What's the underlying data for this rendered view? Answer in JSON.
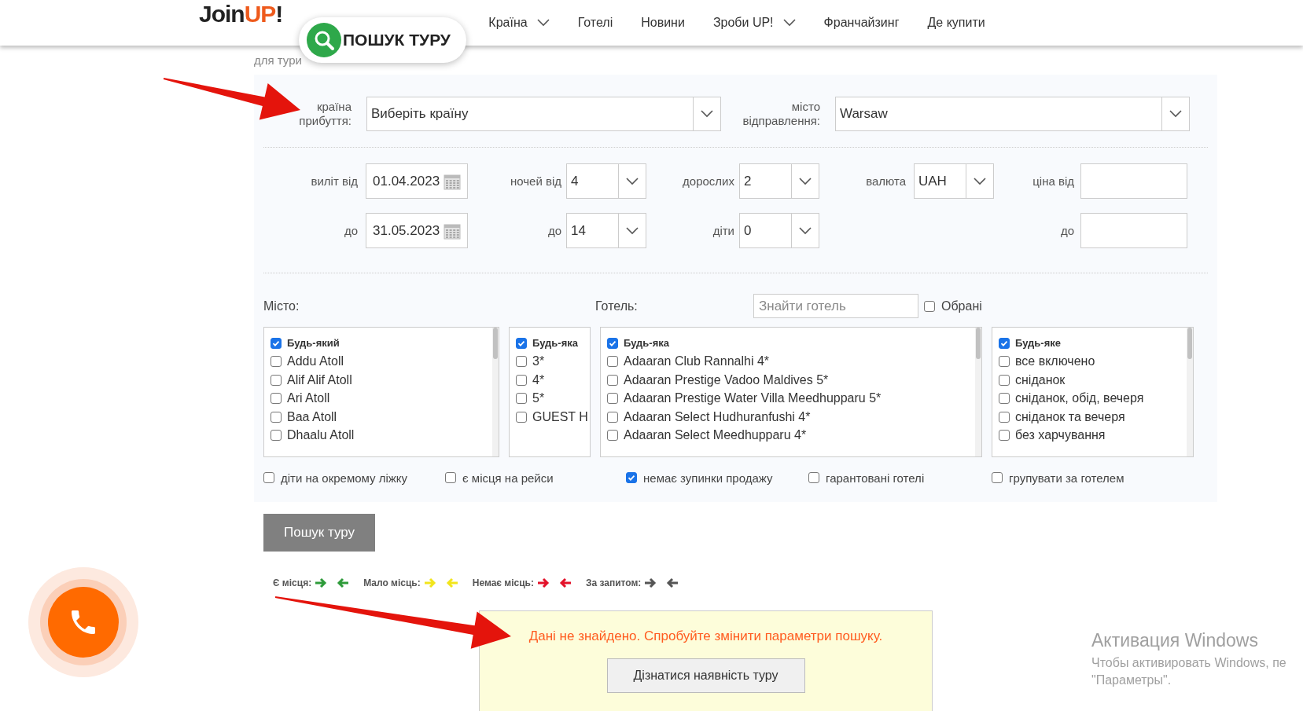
{
  "header": {
    "logo": [
      {
        "text": "Join",
        "color": "#222222"
      },
      {
        "text": "UP",
        "color": "#ee5a1c"
      },
      {
        "text": "!",
        "color": "#222222"
      }
    ],
    "nav": [
      {
        "label": "Країна",
        "dropdown": true
      },
      {
        "label": "Готелі",
        "dropdown": false
      },
      {
        "label": "Новини",
        "dropdown": false
      },
      {
        "label": "Зроби UP!",
        "dropdown": true
      },
      {
        "label": "Франчайзинг",
        "dropdown": false
      },
      {
        "label": "Де купити",
        "dropdown": false
      }
    ],
    "search_button": "ПОШУК ТУРУ"
  },
  "subtitle": "для тури",
  "form": {
    "country": {
      "label": "країна\nприбуття:",
      "value": "Виберіть країну"
    },
    "departure": {
      "label": "місто\nвідправлення:",
      "value": "Warsaw"
    },
    "row_from": [
      {
        "kind": "date",
        "label": "виліт від",
        "value": "01.04.2023"
      },
      {
        "kind": "select",
        "label": "ночей від",
        "value": "4"
      },
      {
        "kind": "select",
        "label": "дорослих",
        "value": "2"
      },
      {
        "kind": "select",
        "label": "валюта",
        "value": "UAH"
      },
      {
        "kind": "input",
        "label": "ціна від"
      }
    ],
    "row_to": [
      {
        "kind": "date",
        "label": "до",
        "value": "31.05.2023"
      },
      {
        "kind": "select",
        "label": "до",
        "value": "14"
      },
      {
        "kind": "select",
        "label": "діти",
        "value": "0"
      },
      {
        "kind": "blank"
      },
      {
        "kind": "input",
        "label": "до"
      }
    ],
    "city_label": "Місто:",
    "hotel_label": "Готель:",
    "hotel_search": {
      "placeholder": "Знайти готель"
    },
    "favorites": {
      "label": "Обрані",
      "checked": false
    },
    "lists": [
      {
        "items": [
          {
            "kind": "any",
            "label": "Будь-який",
            "checked": true
          },
          {
            "kind": "option",
            "label": "Addu Atoll",
            "checked": false
          },
          {
            "kind": "option",
            "label": "Alif Alif Atoll",
            "checked": false
          },
          {
            "kind": "option",
            "label": "Ari Atoll",
            "checked": false
          },
          {
            "kind": "option",
            "label": "Baa Atoll",
            "checked": false
          },
          {
            "kind": "option",
            "label": "Dhaalu Atoll",
            "checked": false
          }
        ]
      },
      {
        "items": [
          {
            "kind": "any",
            "label": "Будь-яка",
            "checked": true
          },
          {
            "kind": "option",
            "label": "3*",
            "checked": false
          },
          {
            "kind": "option",
            "label": "4*",
            "checked": false
          },
          {
            "kind": "option",
            "label": "5*",
            "checked": false
          },
          {
            "kind": "option",
            "label": "GUEST H",
            "checked": false
          }
        ]
      },
      {
        "items": [
          {
            "kind": "any",
            "label": "Будь-яка",
            "checked": true
          },
          {
            "kind": "option",
            "label": "Adaaran Club Rannalhi 4*",
            "checked": false
          },
          {
            "kind": "option",
            "label": "Adaaran Prestige Vadoo Maldives 5*",
            "checked": false
          },
          {
            "kind": "option",
            "label": "Adaaran Prestige Water Villa Meedhupparu 5*",
            "checked": false
          },
          {
            "kind": "option",
            "label": "Adaaran Select Hudhuranfushi 4*",
            "checked": false
          },
          {
            "kind": "option",
            "label": "Adaaran Select Meedhupparu 4*",
            "checked": false
          }
        ]
      },
      {
        "items": [
          {
            "kind": "any",
            "label": "Будь-яке",
            "checked": true
          },
          {
            "kind": "option",
            "label": "все включено",
            "checked": false
          },
          {
            "kind": "option",
            "label": "сніданок",
            "checked": false
          },
          {
            "kind": "option",
            "label": "сніданок, обід, вечеря",
            "checked": false
          },
          {
            "kind": "option",
            "label": "сніданок та вечеря",
            "checked": false
          },
          {
            "kind": "option",
            "label": "без харчування",
            "checked": false
          }
        ]
      }
    ],
    "options": [
      {
        "label": "діти на окремому ліжку",
        "checked": false
      },
      {
        "label": "є місця на рейси",
        "checked": false
      },
      {
        "label": "немає зупинки продажу",
        "checked": true
      },
      {
        "label": "гарантовані готелі",
        "checked": false
      },
      {
        "label": "групувати за готелем",
        "checked": false
      }
    ],
    "submit": "Пошук туру"
  },
  "legend": [
    {
      "label": "Є місця:",
      "color": "#2e9b3a"
    },
    {
      "label": "Мало місць:",
      "color": "#f2e51c"
    },
    {
      "label": "Немає місць:",
      "color": "#e3122a"
    },
    {
      "label": "За запитом:",
      "color": "#555555"
    }
  ],
  "result": {
    "message": "Дані не знайдено. Спробуйте змінити параметри пошуку.",
    "button": "Дізнатися наявність туру"
  },
  "windows_notice": {
    "title": "Активация Windows",
    "lines": [
      "Чтобы активировать Windows, пе",
      "\"Параметры\"."
    ]
  }
}
